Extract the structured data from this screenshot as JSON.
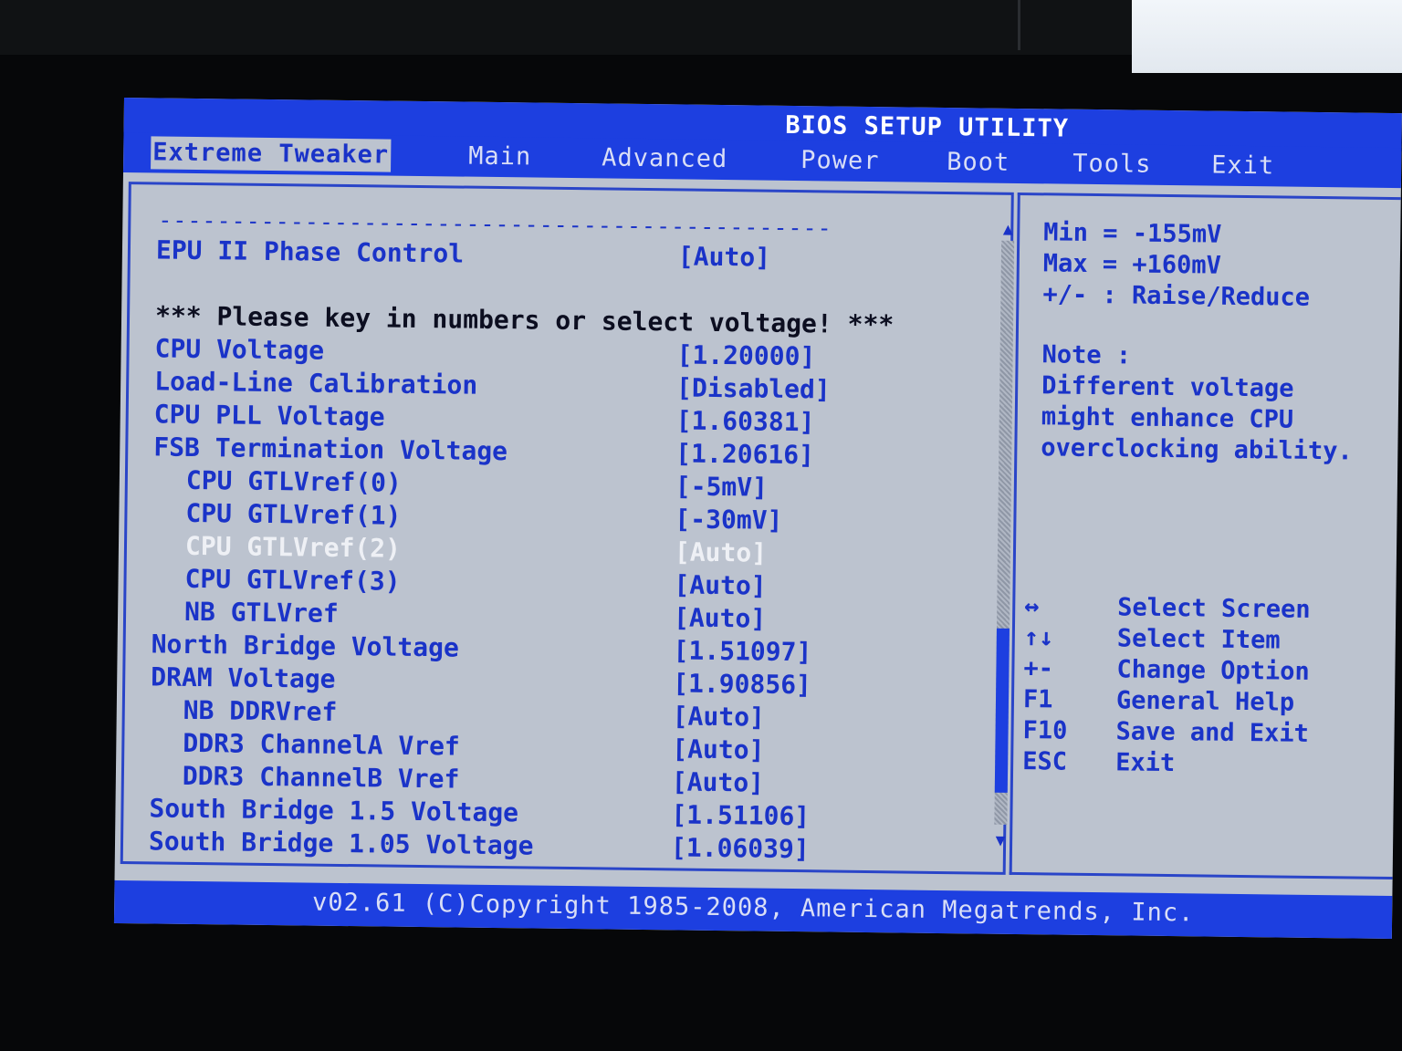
{
  "title": "BIOS SETUP UTILITY",
  "menu": [
    {
      "label": "Extreme Tweaker",
      "active": true
    },
    {
      "label": "Main"
    },
    {
      "label": "Advanced"
    },
    {
      "label": "Power"
    },
    {
      "label": "Boot"
    },
    {
      "label": "Tools"
    },
    {
      "label": "Exit"
    }
  ],
  "main": {
    "separator": "----------------------------------------------",
    "epu": {
      "label": "EPU II Phase Control",
      "value": "[Auto]"
    },
    "notice": "*** Please key in numbers or select voltage!  ***",
    "settings": [
      {
        "label": "CPU Voltage",
        "value": "[1.20000]"
      },
      {
        "label": "Load-Line Calibration",
        "value": "[Disabled]"
      },
      {
        "label": "CPU PLL Voltage",
        "value": "[1.60381]"
      },
      {
        "label": "FSB Termination Voltage",
        "value": "[1.20616]"
      },
      {
        "label": "CPU GTLVref(0)",
        "value": "[-5mV]",
        "indent": true
      },
      {
        "label": "CPU GTLVref(1)",
        "value": "[-30mV]",
        "indent": true
      },
      {
        "label": "CPU GTLVref(2)",
        "value": "[Auto]",
        "indent": true,
        "disabled": true
      },
      {
        "label": "CPU GTLVref(3)",
        "value": "[Auto]",
        "indent": true
      },
      {
        "label": "NB GTLVref",
        "value": "[Auto]",
        "indent": true
      },
      {
        "label": "North Bridge Voltage",
        "value": "[1.51097]"
      },
      {
        "label": "DRAM Voltage",
        "value": "[1.90856]"
      },
      {
        "label": "NB DDRVref",
        "value": "[Auto]",
        "indent": true
      },
      {
        "label": "DDR3 ChannelA Vref",
        "value": "[Auto]",
        "indent": true
      },
      {
        "label": "DDR3 ChannelB Vref",
        "value": "[Auto]",
        "indent": true
      },
      {
        "label": "South Bridge 1.5 Voltage",
        "value": "[1.51106]"
      },
      {
        "label": "South Bridge 1.05 Voltage",
        "value": "[1.06039]"
      }
    ]
  },
  "help": {
    "min": "Min = -155mV",
    "max": "Max = +160mV",
    "adjust": "+/- : Raise/Reduce",
    "note_title": "Note :",
    "note_lines": [
      "Different voltage",
      "might enhance CPU",
      "overclocking ability."
    ],
    "keys": [
      {
        "key": "↔",
        "desc": "Select Screen"
      },
      {
        "key": "↑↓",
        "desc": "Select Item"
      },
      {
        "key": "+-",
        "desc": "Change Option"
      },
      {
        "key": "F1",
        "desc": "General Help"
      },
      {
        "key": "F10",
        "desc": "Save and Exit"
      },
      {
        "key": "ESC",
        "desc": "Exit"
      }
    ]
  },
  "footer": "v02.61 (C)Copyright 1985-2008, American Megatrends, Inc.",
  "colors": {
    "bar_blue": "#1d3fe0",
    "panel_gray": "#bcc3cf",
    "text_blue": "#1a33c8"
  }
}
